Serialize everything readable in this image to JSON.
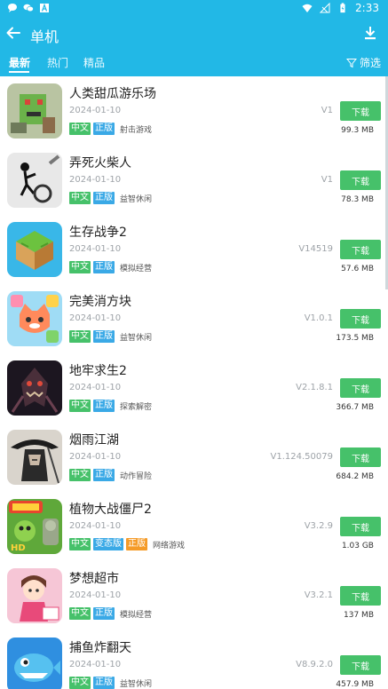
{
  "status_bar": {
    "time": "2:33"
  },
  "header": {
    "title": "单机"
  },
  "tabs": [
    {
      "label": "最新",
      "active": true
    },
    {
      "label": "热门",
      "active": false
    },
    {
      "label": "精品",
      "active": false
    }
  ],
  "filter_label": "筛选",
  "colors": {
    "primary": "#22b8e6",
    "download": "#46c16a",
    "tag_blue": "#3aa9e6",
    "tag_orange": "#f59b28"
  },
  "apps": [
    {
      "name": "人类甜瓜游乐场",
      "date": "2024-01-10",
      "version": "V1",
      "size": "99.3 MB",
      "tags": [
        "中文",
        "正版"
      ],
      "category": "射击游戏",
      "button": "下载"
    },
    {
      "name": "弄死火柴人",
      "date": "2024-01-10",
      "version": "V1",
      "size": "78.3 MB",
      "tags": [
        "中文",
        "正版"
      ],
      "category": "益智休闲",
      "button": "下载"
    },
    {
      "name": "生存战争2",
      "date": "2024-01-10",
      "version": "V14519",
      "size": "57.6 MB",
      "tags": [
        "中文",
        "正版"
      ],
      "category": "模拟经营",
      "button": "下载"
    },
    {
      "name": "完美消方块",
      "date": "2024-01-10",
      "version": "V1.0.1",
      "size": "173.5 MB",
      "tags": [
        "中文",
        "正版"
      ],
      "category": "益智休闲",
      "button": "下载"
    },
    {
      "name": "地牢求生2",
      "date": "2024-01-10",
      "version": "V2.1.8.1",
      "size": "366.7 MB",
      "tags": [
        "中文",
        "正版"
      ],
      "category": "探索解密",
      "button": "下载"
    },
    {
      "name": "烟雨江湖",
      "date": "2024-01-10",
      "version": "V1.124.50079",
      "size": "684.2 MB",
      "tags": [
        "中文",
        "正版"
      ],
      "category": "动作冒险",
      "button": "下载"
    },
    {
      "name": "植物大战僵尸2",
      "date": "2024-01-10",
      "version": "V3.2.9",
      "size": "1.03 GB",
      "tags": [
        "中文",
        "变态版",
        "正版"
      ],
      "category": "网络游戏",
      "button": "下载"
    },
    {
      "name": "梦想超市",
      "date": "2024-01-10",
      "version": "V3.2.1",
      "size": "137 MB",
      "tags": [
        "中文",
        "正版"
      ],
      "category": "模拟经营",
      "button": "下载"
    },
    {
      "name": "捕鱼炸翻天",
      "date": "2024-01-10",
      "version": "V8.9.2.0",
      "size": "457.9 MB",
      "tags": [
        "中文",
        "正版"
      ],
      "category": "益智休闲",
      "button": "下载"
    }
  ]
}
